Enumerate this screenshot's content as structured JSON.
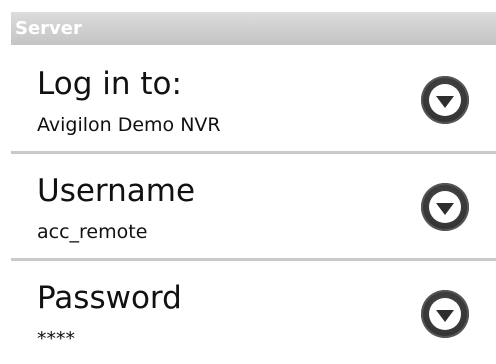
{
  "section": {
    "title": "Server"
  },
  "rows": [
    {
      "title": "Log in to:",
      "value": "Avigilon Demo NVR",
      "icon": "chevron-down-icon"
    },
    {
      "title": "Username",
      "value": "acc_remote",
      "icon": "chevron-down-icon"
    },
    {
      "title": "Password",
      "value": "****",
      "icon": "chevron-down-icon"
    }
  ]
}
